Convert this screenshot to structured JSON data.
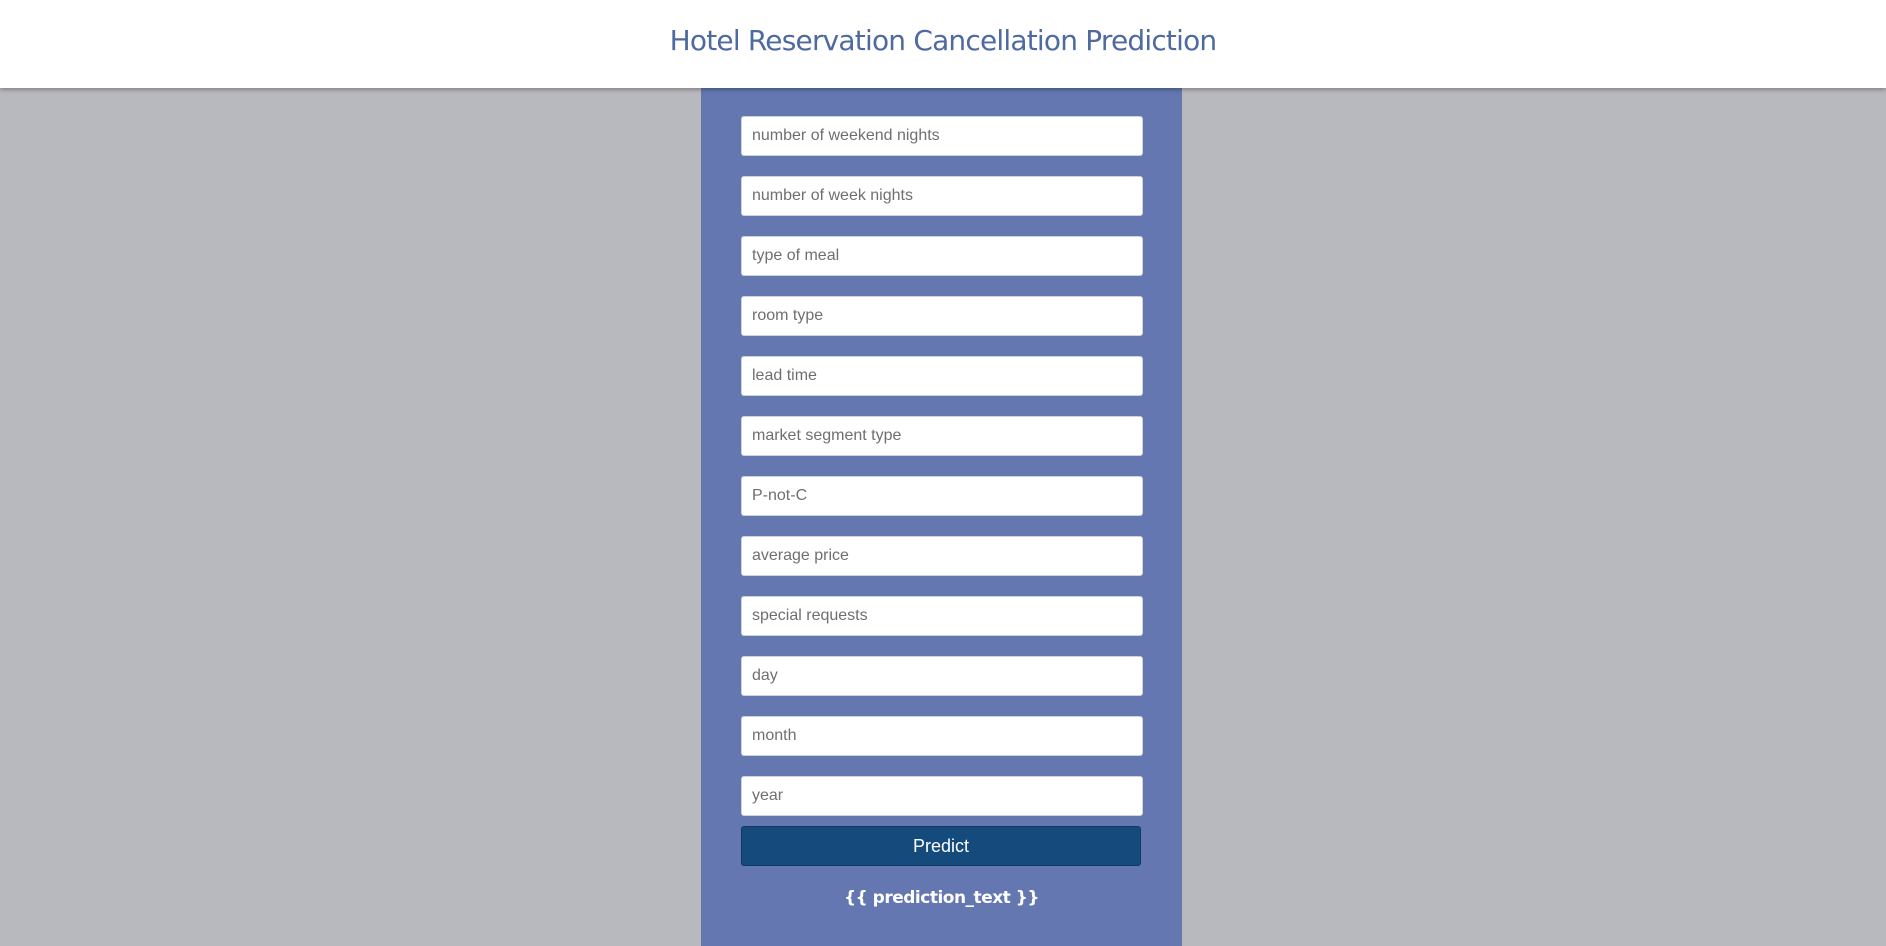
{
  "header": {
    "title": "Hotel Reservation Cancellation Prediction"
  },
  "form": {
    "fields": [
      {
        "placeholder": "number of weekend nights",
        "value": ""
      },
      {
        "placeholder": "number of week nights",
        "value": ""
      },
      {
        "placeholder": "type of meal",
        "value": ""
      },
      {
        "placeholder": "room type",
        "value": ""
      },
      {
        "placeholder": "lead time",
        "value": ""
      },
      {
        "placeholder": "market segment type",
        "value": ""
      },
      {
        "placeholder": "P-not-C",
        "value": ""
      },
      {
        "placeholder": "average price",
        "value": ""
      },
      {
        "placeholder": "special requests",
        "value": ""
      },
      {
        "placeholder": "day",
        "value": ""
      },
      {
        "placeholder": "month",
        "value": ""
      },
      {
        "placeholder": "year",
        "value": ""
      }
    ],
    "submit_label": "Predict"
  },
  "result": {
    "text": "{{ prediction_text }}"
  },
  "colors": {
    "background": "#b8b9be",
    "header_background": "#ffffff",
    "title": "#4e6aa1",
    "panel": "#6477b0",
    "button": "#154a7c",
    "result_text": "#ffffff"
  }
}
